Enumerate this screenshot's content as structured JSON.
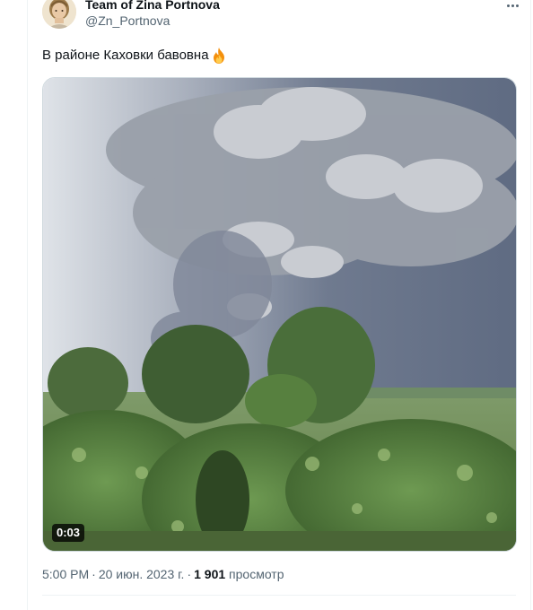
{
  "author": {
    "display_name": "Team of Zina Portnova",
    "handle": "@Zn_Portnova",
    "avatar_icon": "avatar-portrait-icon"
  },
  "more_icon": "more-options-icon",
  "tweet": {
    "text": "В районе Каховки бавовна",
    "emoji_icon": "fire-icon"
  },
  "video": {
    "duration": "0:03",
    "play_icon": "video-thumbnail"
  },
  "meta": {
    "time": "5:00 PM",
    "separator": "·",
    "date": "20 июн. 2023 г.",
    "views_count": "1 901",
    "views_label": "просмотр"
  },
  "colors": {
    "text_primary": "#0f1419",
    "text_secondary": "#536471",
    "border": "#cfd9de",
    "divider": "#eff3f4"
  }
}
